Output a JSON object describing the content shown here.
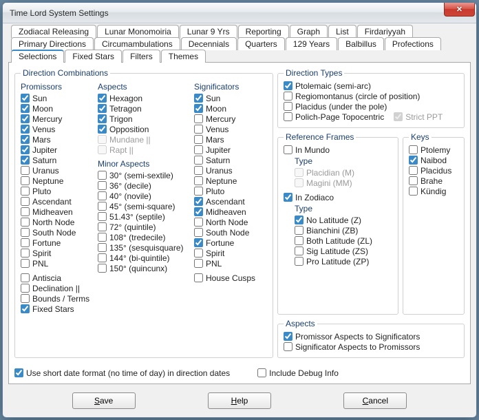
{
  "window": {
    "title": "Time Lord System Settings",
    "close": "✕"
  },
  "tabs": {
    "row1": [
      "Zodiacal Releasing",
      "Lunar Monomoiria",
      "Lunar 9 Yrs",
      "Reporting",
      "Graph",
      "List",
      "Firdariyyah"
    ],
    "row2": [
      "Primary Directions",
      "Circumambulations",
      "Decennials",
      "Quarters",
      "129 Years",
      "Balbillus",
      "Profections"
    ],
    "row3": [
      "Selections",
      "Fixed Stars",
      "Filters",
      "Themes"
    ],
    "selectedRow": 2,
    "selectedIndex": 0
  },
  "groups": {
    "directionCombinations": "Direction Combinations",
    "directionTypes": "Direction Types",
    "referenceFrames": "Reference Frames",
    "keys": "Keys",
    "aspectsGroup": "Aspects"
  },
  "headers": {
    "promissors": "Promissors",
    "aspects": "Aspects",
    "significators": "Significators",
    "minorAspects": "Minor Aspects",
    "type": "Type"
  },
  "promissors": [
    {
      "label": "Sun",
      "checked": true
    },
    {
      "label": "Moon",
      "checked": true
    },
    {
      "label": "Mercury",
      "checked": true
    },
    {
      "label": "Venus",
      "checked": true
    },
    {
      "label": "Mars",
      "checked": true
    },
    {
      "label": "Jupiter",
      "checked": true
    },
    {
      "label": "Saturn",
      "checked": true
    },
    {
      "label": "Uranus",
      "checked": false
    },
    {
      "label": "Neptune",
      "checked": false
    },
    {
      "label": "Pluto",
      "checked": false
    },
    {
      "label": "Ascendant",
      "checked": false
    },
    {
      "label": "Midheaven",
      "checked": false
    },
    {
      "label": "North Node",
      "checked": false
    },
    {
      "label": "South Node",
      "checked": false
    },
    {
      "label": "Fortune",
      "checked": false
    },
    {
      "label": "Spirit",
      "checked": false
    },
    {
      "label": "PNL",
      "checked": false
    }
  ],
  "promissorsExtra": [
    {
      "label": "Antiscia",
      "checked": false
    },
    {
      "label": "Declination ||",
      "checked": false
    },
    {
      "label": "Bounds / Terms",
      "checked": false
    },
    {
      "label": "Fixed Stars",
      "checked": true
    }
  ],
  "aspects": [
    {
      "label": "Hexagon",
      "checked": true
    },
    {
      "label": "Tetragon",
      "checked": true
    },
    {
      "label": "Trigon",
      "checked": true
    },
    {
      "label": "Opposition",
      "checked": true
    },
    {
      "label": "Mundane ||",
      "checked": false,
      "disabled": true
    },
    {
      "label": "Rapt ||",
      "checked": false,
      "disabled": true
    }
  ],
  "minorAspects": [
    {
      "label": "30° (semi-sextile)",
      "checked": false
    },
    {
      "label": "36° (decile)",
      "checked": false
    },
    {
      "label": "40° (novile)",
      "checked": false
    },
    {
      "label": "45° (semi-square)",
      "checked": false
    },
    {
      "label": "51.43° (septile)",
      "checked": false
    },
    {
      "label": "72° (quintile)",
      "checked": false
    },
    {
      "label": "108° (tredecile)",
      "checked": false
    },
    {
      "label": "135° (sesquisquare)",
      "checked": false
    },
    {
      "label": "144° (bi-quintile)",
      "checked": false
    },
    {
      "label": "150° (quincunx)",
      "checked": false
    }
  ],
  "significators": [
    {
      "label": "Sun",
      "checked": true
    },
    {
      "label": "Moon",
      "checked": true
    },
    {
      "label": "Mercury",
      "checked": false
    },
    {
      "label": "Venus",
      "checked": false
    },
    {
      "label": "Mars",
      "checked": false
    },
    {
      "label": "Jupiter",
      "checked": false
    },
    {
      "label": "Saturn",
      "checked": false
    },
    {
      "label": "Uranus",
      "checked": false
    },
    {
      "label": "Neptune",
      "checked": false
    },
    {
      "label": "Pluto",
      "checked": false
    },
    {
      "label": "Ascendant",
      "checked": true
    },
    {
      "label": "Midheaven",
      "checked": true
    },
    {
      "label": "North Node",
      "checked": false
    },
    {
      "label": "South Node",
      "checked": false
    },
    {
      "label": "Fortune",
      "checked": true
    },
    {
      "label": "Spirit",
      "checked": false
    },
    {
      "label": "PNL",
      "checked": false
    }
  ],
  "houseCusps": {
    "label": "House Cusps",
    "checked": false
  },
  "directionTypes": [
    {
      "label": "Ptolemaic (semi-arc)",
      "checked": true
    },
    {
      "label": "Regiomontanus (circle of position)",
      "checked": false
    },
    {
      "label": "Placidus (under the pole)",
      "checked": false
    },
    {
      "label": "Polich-Page Topocentric",
      "checked": false
    }
  ],
  "strictPPT": {
    "label": "Strict PPT",
    "checked": true,
    "disabled": true
  },
  "refFrames": {
    "inMundo": {
      "label": "In Mundo",
      "checked": false
    },
    "mundoTypes": [
      {
        "label": "Placidian (M)",
        "checked": false,
        "disabled": true
      },
      {
        "label": "Magini (MM)",
        "checked": false,
        "disabled": true
      }
    ],
    "inZodiaco": {
      "label": "In Zodiaco",
      "checked": true
    },
    "zodTypes": [
      {
        "label": "No Latitude (Z)",
        "checked": true
      },
      {
        "label": "Bianchini (ZB)",
        "checked": false
      },
      {
        "label": "Both Latitude (ZL)",
        "checked": false
      },
      {
        "label": "Sig Latitude (ZS)",
        "checked": false
      },
      {
        "label": "Pro Latitude (ZP)",
        "checked": false
      }
    ]
  },
  "keys": [
    {
      "label": "Ptolemy",
      "checked": false
    },
    {
      "label": "Naibod",
      "checked": true
    },
    {
      "label": "Placidus",
      "checked": false
    },
    {
      "label": "Brahe",
      "checked": false
    },
    {
      "label": "Kündig",
      "checked": false
    }
  ],
  "aspectsGroup": [
    {
      "label": "Promissor Aspects to Significators",
      "checked": true
    },
    {
      "label": "Significator Aspects to Promissors",
      "checked": false
    }
  ],
  "bottom": {
    "shortDate": {
      "label": "Use short date format (no time of day) in direction dates",
      "checked": true
    },
    "debug": {
      "label": "Include Debug Info",
      "checked": false
    }
  },
  "buttons": {
    "save": "Save",
    "help": "Help",
    "cancel": "Cancel"
  }
}
